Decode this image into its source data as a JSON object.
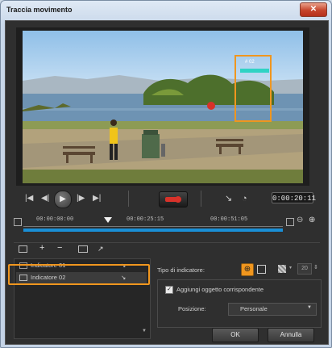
{
  "window": {
    "title": "Traccia movimento",
    "close_label": "✕"
  },
  "preview": {
    "tracker_tag": "# 02"
  },
  "transport": {
    "timecode": "0:00:20:11",
    "first_icon": "skip-to-start-icon",
    "prev_icon": "step-back-icon",
    "play_icon": "play-icon",
    "next_icon": "step-forward-icon",
    "last_icon": "skip-to-end-icon"
  },
  "timeline": {
    "ticks": [
      "00:00:00:00",
      "00:00:25:15",
      "00:00:51:05"
    ]
  },
  "indicators": {
    "items": [
      {
        "label": "Indicatore 01"
      },
      {
        "label": "Indicatore 02"
      }
    ]
  },
  "props": {
    "type_label": "Tipo di indicatore:",
    "size_value": "20",
    "add_object_label": "Aggiungi oggetto corrispondente",
    "position_label": "Posizione:",
    "position_value": "Personale"
  },
  "footer": {
    "ok_label": "OK",
    "cancel_label": "Annulla"
  },
  "colors": {
    "accent": "#f0961e",
    "track": "#1a8fd6",
    "record": "#d8322a"
  }
}
